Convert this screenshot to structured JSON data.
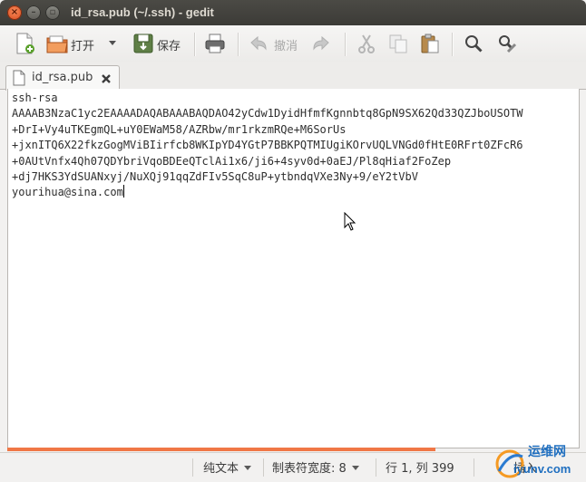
{
  "window": {
    "title": "id_rsa.pub (~/.ssh) - gedit"
  },
  "toolbar": {
    "new_icon": "new-document-icon",
    "open_label": "打开",
    "save_label": "保存",
    "print_icon": "print-icon",
    "undo_label": "撤消",
    "redo_icon": "redo-icon",
    "cut_icon": "cut-icon",
    "copy_icon": "copy-icon",
    "paste_icon": "paste-icon",
    "find_icon": "search-icon",
    "replace_icon": "find-replace-icon"
  },
  "tabs": [
    {
      "label": "id_rsa.pub"
    }
  ],
  "document": {
    "lines": [
      "ssh-rsa",
      "AAAAB3NzaC1yc2EAAAADAQABAAABAQDAO42yCdw1DyidHfmfKgnnbtq8GpN9SX62Qd33QZJboUSOTW",
      "+DrI+Vy4uTKEgmQL+uY0EWaM58/AZRbw/mr1rkzmRQe+M6SorUs",
      "+jxnITQ6X22fkzGogMViBIirfcb8WKIpYD4YGtP7BBKPQTMIUgiKOrvUQLVNGd0fHtE0RFrt0ZFcR6",
      "+0AUtVnfx4Qh07QDYbriVqoBDEeQTclAi1x6/ji6+4syv0d+0aEJ/Pl8qHiaf2FoZep",
      "+dj7HKS3YdSUANxyj/NuXQj91qqZdFIv5SqC8uP+ytbndqVXe3Ny+9/eY2tVbV",
      "yourihua@sina.com"
    ]
  },
  "statusbar": {
    "language": "纯文本",
    "tab_width": "制表符宽度: 8",
    "position": "行 1, 列 399",
    "mode": "插入"
  },
  "watermark": {
    "text1": "运维网",
    "text2": "iyunv.com"
  },
  "colors": {
    "titlebar": "#3c3b37",
    "close_button": "#e05a26",
    "accent_bar": "#f07746"
  }
}
